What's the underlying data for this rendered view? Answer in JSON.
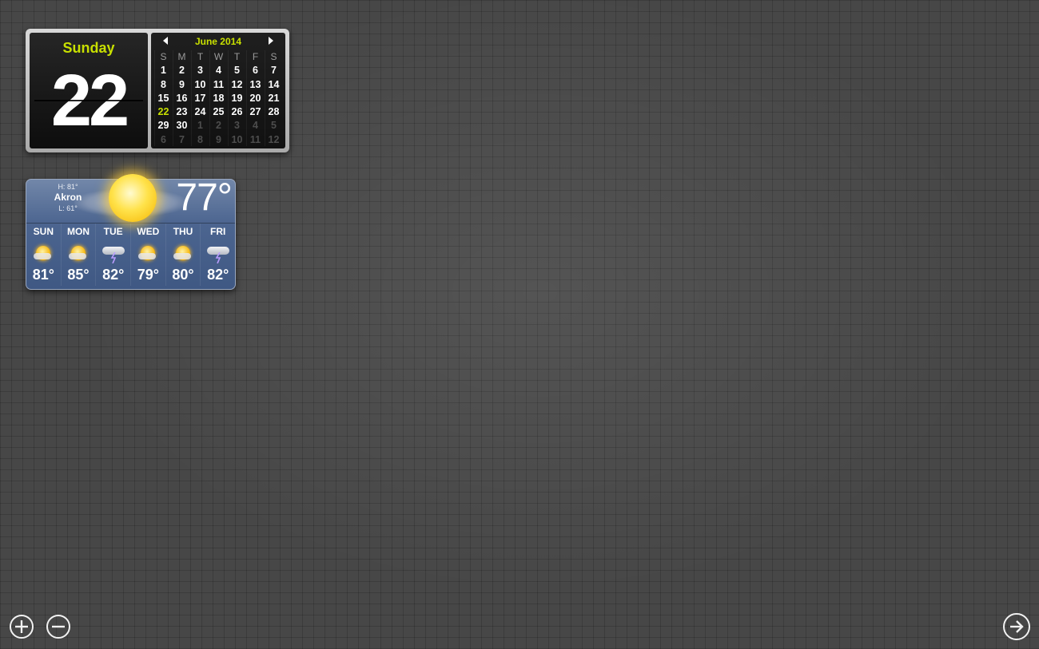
{
  "calendar": {
    "weekday": "Sunday",
    "date": "22",
    "month_label": "June 2014",
    "weekday_headers": [
      "S",
      "M",
      "T",
      "W",
      "T",
      "F",
      "S"
    ],
    "today": "22",
    "weeks": [
      [
        {
          "d": "1"
        },
        {
          "d": "2"
        },
        {
          "d": "3"
        },
        {
          "d": "4"
        },
        {
          "d": "5"
        },
        {
          "d": "6"
        },
        {
          "d": "7"
        }
      ],
      [
        {
          "d": "8"
        },
        {
          "d": "9"
        },
        {
          "d": "10"
        },
        {
          "d": "11"
        },
        {
          "d": "12"
        },
        {
          "d": "13"
        },
        {
          "d": "14"
        }
      ],
      [
        {
          "d": "15"
        },
        {
          "d": "16"
        },
        {
          "d": "17"
        },
        {
          "d": "18"
        },
        {
          "d": "19"
        },
        {
          "d": "20"
        },
        {
          "d": "21"
        }
      ],
      [
        {
          "d": "22",
          "today": true
        },
        {
          "d": "23"
        },
        {
          "d": "24"
        },
        {
          "d": "25"
        },
        {
          "d": "26"
        },
        {
          "d": "27"
        },
        {
          "d": "28"
        }
      ],
      [
        {
          "d": "29"
        },
        {
          "d": "30"
        },
        {
          "d": "1",
          "dim": true
        },
        {
          "d": "2",
          "dim": true
        },
        {
          "d": "3",
          "dim": true
        },
        {
          "d": "4",
          "dim": true
        },
        {
          "d": "5",
          "dim": true
        }
      ],
      [
        {
          "d": "6",
          "dim": true
        },
        {
          "d": "7",
          "dim": true
        },
        {
          "d": "8",
          "dim": true
        },
        {
          "d": "9",
          "dim": true
        },
        {
          "d": "10",
          "dim": true
        },
        {
          "d": "11",
          "dim": true
        },
        {
          "d": "12",
          "dim": true
        }
      ]
    ],
    "accent_color": "#c8e000"
  },
  "weather": {
    "city": "Akron",
    "high": "H: 81°",
    "low": "L: 61°",
    "current_temp": "77°",
    "current_icon": "sun-icon",
    "forecast": [
      {
        "day": "SUN",
        "temp": "81°",
        "icon": "partly-sunny-icon"
      },
      {
        "day": "MON",
        "temp": "85°",
        "icon": "partly-sunny-icon"
      },
      {
        "day": "TUE",
        "temp": "82°",
        "icon": "thunderstorm-icon"
      },
      {
        "day": "WED",
        "temp": "79°",
        "icon": "partly-sunny-icon"
      },
      {
        "day": "THU",
        "temp": "80°",
        "icon": "partly-sunny-icon"
      },
      {
        "day": "FRI",
        "temp": "82°",
        "icon": "thunderstorm-icon"
      }
    ]
  },
  "controls": {
    "add_icon": "plus-circle-icon",
    "remove_icon": "minus-circle-icon",
    "next_icon": "arrow-right-circle-icon"
  }
}
